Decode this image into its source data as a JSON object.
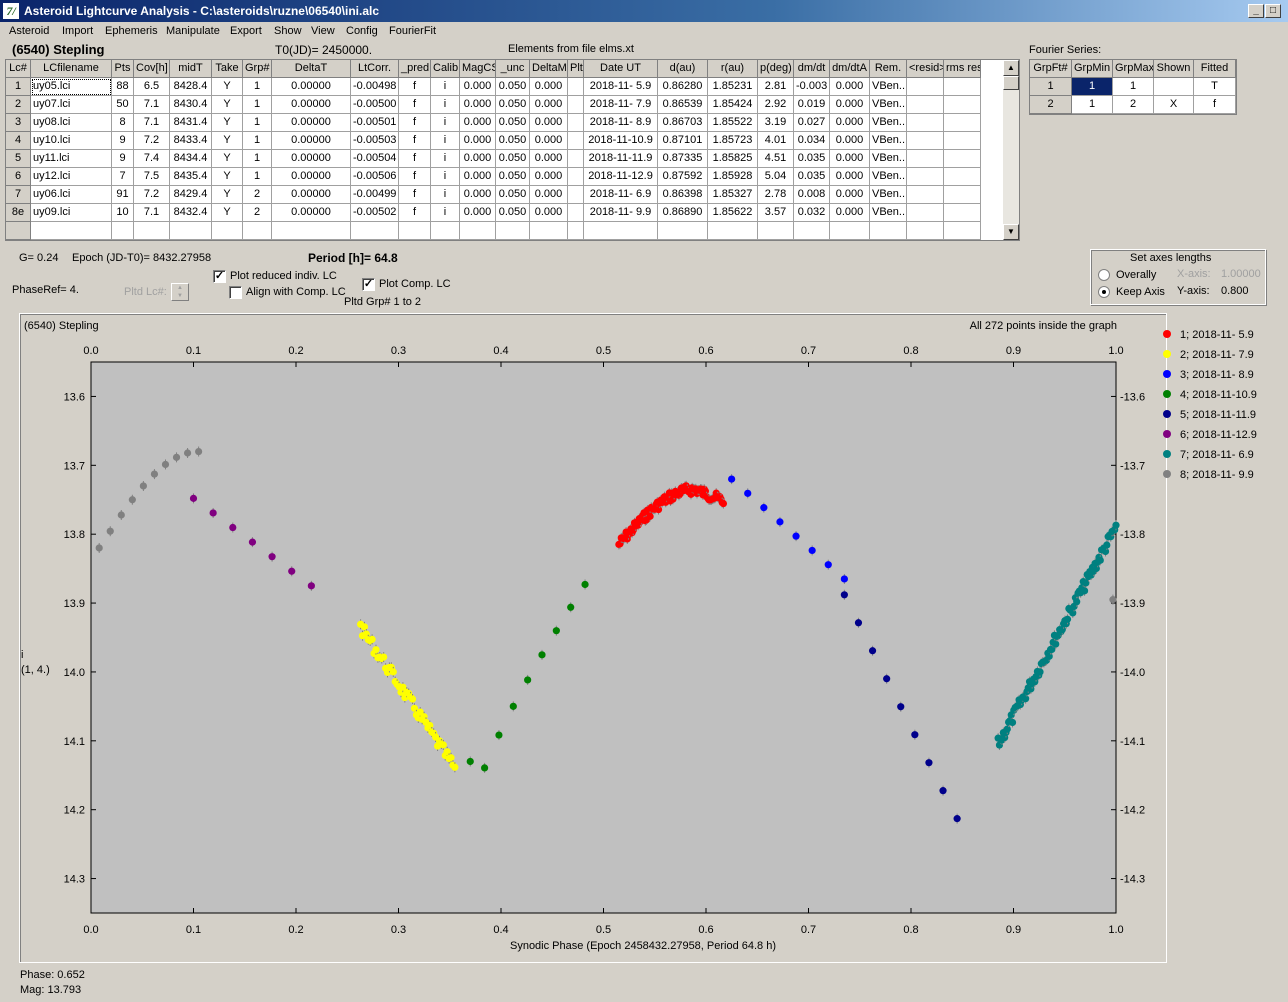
{
  "window": {
    "title": "Asteroid Lightcurve Analysis - C:\\asteroids\\ruzne\\06540\\ini.alc",
    "icon_glyph": "7/"
  },
  "menu": [
    "Asteroid",
    "Import",
    "Ephemeris",
    "Manipulate",
    "Export",
    "Show",
    "View",
    "Config",
    "FourierFit"
  ],
  "header": {
    "asteroid": "(6540) Stepling",
    "t0": "T0(JD)= 2450000.",
    "elements": "Elements from file elms.xt"
  },
  "table": {
    "columns": [
      "Lc#",
      "LCfilename",
      "Pts",
      "Cov[h]",
      "midT",
      "Take",
      "Grp#",
      "DeltaT",
      "LtCorr.",
      "_pred.",
      "Calib.",
      "MagCS",
      "_unc",
      "DeltaM",
      "Plt",
      "Date UT",
      "d(au)",
      "r(au)",
      "p(deg)",
      "dm/dt",
      "dm/dtA",
      "Rem.",
      "<resid>",
      "rms res"
    ],
    "rows": [
      [
        "1",
        "uy05.lci",
        "88",
        "6.5",
        "8428.4",
        "Y",
        "1",
        "0.00000",
        "-0.00498",
        "f",
        "i",
        "0.000",
        "0.050",
        "0.000",
        "",
        "2018-11- 5.9",
        "0.86280",
        "1.85231",
        "2.81",
        "-0.003",
        "0.000",
        "VBen..",
        "",
        ""
      ],
      [
        "2",
        "uy07.lci",
        "50",
        "7.1",
        "8430.4",
        "Y",
        "1",
        "0.00000",
        "-0.00500",
        "f",
        "i",
        "0.000",
        "0.050",
        "0.000",
        "",
        "2018-11- 7.9",
        "0.86539",
        "1.85424",
        "2.92",
        "0.019",
        "0.000",
        "VBen..",
        "",
        ""
      ],
      [
        "3",
        "uy08.lci",
        "8",
        "7.1",
        "8431.4",
        "Y",
        "1",
        "0.00000",
        "-0.00501",
        "f",
        "i",
        "0.000",
        "0.050",
        "0.000",
        "",
        "2018-11- 8.9",
        "0.86703",
        "1.85522",
        "3.19",
        "0.027",
        "0.000",
        "VBen..",
        "",
        ""
      ],
      [
        "4",
        "uy10.lci",
        "9",
        "7.2",
        "8433.4",
        "Y",
        "1",
        "0.00000",
        "-0.00503",
        "f",
        "i",
        "0.000",
        "0.050",
        "0.000",
        "",
        "2018-11-10.9",
        "0.87101",
        "1.85723",
        "4.01",
        "0.034",
        "0.000",
        "VBen..",
        "",
        ""
      ],
      [
        "5",
        "uy11.lci",
        "9",
        "7.4",
        "8434.4",
        "Y",
        "1",
        "0.00000",
        "-0.00504",
        "f",
        "i",
        "0.000",
        "0.050",
        "0.000",
        "",
        "2018-11-11.9",
        "0.87335",
        "1.85825",
        "4.51",
        "0.035",
        "0.000",
        "VBen..",
        "",
        ""
      ],
      [
        "6",
        "uy12.lci",
        "7",
        "7.5",
        "8435.4",
        "Y",
        "1",
        "0.00000",
        "-0.00506",
        "f",
        "i",
        "0.000",
        "0.050",
        "0.000",
        "",
        "2018-11-12.9",
        "0.87592",
        "1.85928",
        "5.04",
        "0.035",
        "0.000",
        "VBen..",
        "",
        ""
      ],
      [
        "7",
        "uy06.lci",
        "91",
        "7.2",
        "8429.4",
        "Y",
        "2",
        "0.00000",
        "-0.00499",
        "f",
        "i",
        "0.000",
        "0.050",
        "0.000",
        "",
        "2018-11- 6.9",
        "0.86398",
        "1.85327",
        "2.78",
        "0.008",
        "0.000",
        "VBen..",
        "",
        ""
      ],
      [
        "8e",
        "uy09.lci",
        "10",
        "7.1",
        "8432.4",
        "Y",
        "2",
        "0.00000",
        "-0.00502",
        "f",
        "i",
        "0.000",
        "0.050",
        "0.000",
        "",
        "2018-11- 9.9",
        "0.86890",
        "1.85622",
        "3.57",
        "0.032",
        "0.000",
        "VBen..",
        "",
        ""
      ]
    ]
  },
  "fourier": {
    "title": "Fourier Series:",
    "columns": [
      "GrpFt#",
      "GrpMin",
      "GrpMax",
      "Shown",
      "Fitted"
    ],
    "rows": [
      [
        "1",
        "1",
        "1",
        "",
        "T"
      ],
      [
        "2",
        "1",
        "2",
        "X",
        "f"
      ]
    ]
  },
  "params": {
    "g": "G= 0.24",
    "epoch": "Epoch (JD-T0)= 8432.27958",
    "period": "Period [h]= 64.8",
    "phaseref": "PhaseRef= 4.",
    "pltd_lc": "Pltd Lc#:",
    "plot_reduced": "Plot reduced indiv. LC",
    "plot_reduced_checked": true,
    "align_comp": "Align with Comp. LC",
    "align_comp_checked": false,
    "plot_comp": "Plot Comp. LC",
    "plot_comp_checked": true,
    "pltd_grp": "Pltd Grp#  1   to   2"
  },
  "axes_box": {
    "title": "Set axes lengths",
    "overally": "Overally",
    "keep_axis": "Keep Axis",
    "x_label": "X-axis:",
    "x_value": "1.00000",
    "y_label": "Y-axis:",
    "y_value": "0.800",
    "selected": "keep_axis"
  },
  "graph": {
    "title": "(6540) Stepling",
    "status": "All 272 points inside the graph"
  },
  "status": {
    "phase": "Phase:  0.652",
    "mag": "Mag:    13.793"
  },
  "chart_data": {
    "type": "scatter",
    "xlabel": "Synodic Phase (Epoch 2458432.27958, Period 64.8 h)",
    "ylabel": "i\n(1, 4.)",
    "xlim": [
      0,
      1
    ],
    "ylim": [
      13.55,
      14.35
    ],
    "y_inverted": true,
    "x_ticks": [
      "0.0",
      "0.1",
      "0.2",
      "0.3",
      "0.4",
      "0.5",
      "0.6",
      "0.7",
      "0.8",
      "0.9",
      "1.0"
    ],
    "y_ticks": [
      "13.6",
      "13.7",
      "13.8",
      "13.9",
      "14.0",
      "14.1",
      "14.2",
      "14.3"
    ],
    "series": [
      {
        "name": "1; 2018-11- 5.9",
        "color": "#ff0000",
        "x_range": [
          0.515,
          0.617
        ],
        "y_start": 13.815,
        "y_end": 13.752,
        "n": 88,
        "shape": "rise",
        "peak_y": 13.735,
        "peak_x": 0.59
      },
      {
        "name": "2; 2018-11- 7.9",
        "color": "#ffff00",
        "x_range": [
          0.263,
          0.355
        ],
        "y_start": 13.935,
        "y_end": 14.14,
        "n": 50,
        "shape": "linear"
      },
      {
        "name": "3; 2018-11- 8.9",
        "color": "#0000ff",
        "x_range": [
          0.625,
          0.735
        ],
        "y_start": 13.72,
        "y_end": 13.865,
        "n": 8,
        "shape": "linear"
      },
      {
        "name": "4; 2018-11-10.9",
        "color": "#008000",
        "x_range": [
          0.37,
          0.482
        ],
        "y_start": 14.13,
        "y_end": 13.873,
        "n": 9,
        "shape": "uturn",
        "min_y": 14.14,
        "min_x": 0.385
      },
      {
        "name": "5; 2018-11-11.9",
        "color": "#00008b",
        "x_range": [
          0.735,
          0.845
        ],
        "y_start": 13.888,
        "y_end": 14.213,
        "n": 9,
        "shape": "linear"
      },
      {
        "name": "6; 2018-11-12.9",
        "color": "#800080",
        "x_range": [
          0.1,
          0.215
        ],
        "y_start": 13.748,
        "y_end": 13.875,
        "n": 7,
        "shape": "linear"
      },
      {
        "name": "7; 2018-11- 6.9",
        "color": "#008080",
        "x_range": [
          0.885,
          1.0
        ],
        "y_start": 14.105,
        "y_end": 13.79,
        "n": 91,
        "shape": "linear"
      },
      {
        "name": "8; 2018-11- 9.9",
        "color": "#808080",
        "x_range": [
          0.008,
          0.105
        ],
        "y_start": 13.82,
        "y_end": 13.68,
        "n": 10,
        "shape": "curve",
        "extra_point": [
          0.997,
          13.895
        ]
      }
    ]
  }
}
